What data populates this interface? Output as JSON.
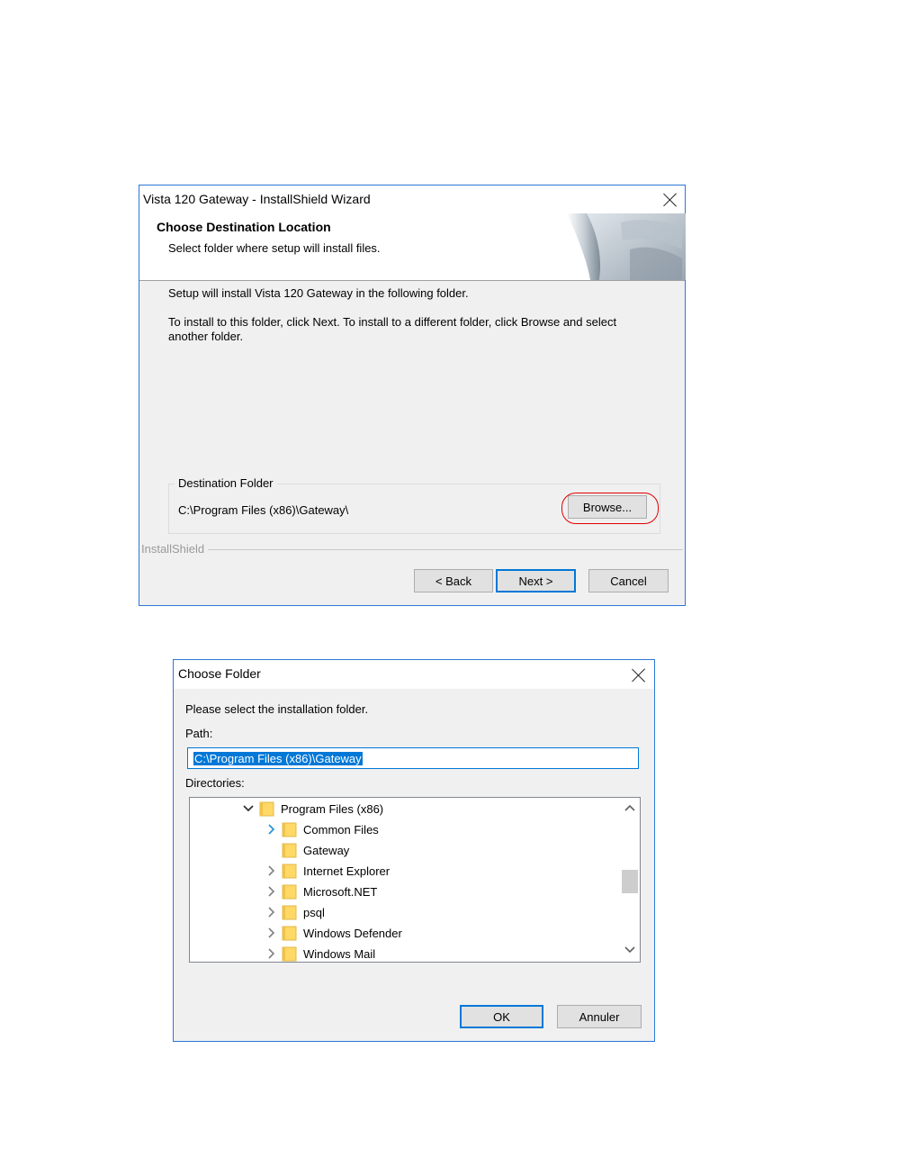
{
  "wizard": {
    "title": "Vista 120 Gateway - InstallShield Wizard",
    "header_title": "Choose Destination Location",
    "header_subtitle": "Select folder where setup will install files.",
    "text_line1": "Setup will install Vista 120 Gateway in the following folder.",
    "text_line2": "To install to this folder, click Next. To install to a different folder, click Browse and select",
    "text_line3": "another folder.",
    "destination_label": "Destination Folder",
    "destination_path": "C:\\Program Files (x86)\\Gateway\\",
    "browse_label": "Browse...",
    "brand": "InstallShield",
    "back_label": "< Back",
    "next_label": "Next >",
    "cancel_label": "Cancel"
  },
  "folder_dialog": {
    "title": "Choose Folder",
    "prompt": "Please select the installation folder.",
    "path_label": "Path:",
    "path_value": "C:\\Program Files (x86)\\Gateway",
    "directories_label": "Directories:",
    "tree": [
      {
        "label": "Program Files (x86)",
        "level": 0,
        "chevron": "expanded"
      },
      {
        "label": "Common Files",
        "level": 1,
        "chevron": "collapsed-highlight"
      },
      {
        "label": "Gateway",
        "level": 1,
        "chevron": "none"
      },
      {
        "label": "Internet Explorer",
        "level": 1,
        "chevron": "collapsed"
      },
      {
        "label": "Microsoft.NET",
        "level": 1,
        "chevron": "collapsed"
      },
      {
        "label": "psql",
        "level": 1,
        "chevron": "collapsed"
      },
      {
        "label": "Windows Defender",
        "level": 1,
        "chevron": "collapsed"
      },
      {
        "label": "Windows Mail",
        "level": 1,
        "chevron": "collapsed"
      }
    ],
    "ok_label": "OK",
    "annuler_label": "Annuler"
  },
  "colors": {
    "accent": "#0078d7",
    "highlight_ring": "#e00000",
    "folder_yellow": "#ffd866"
  }
}
